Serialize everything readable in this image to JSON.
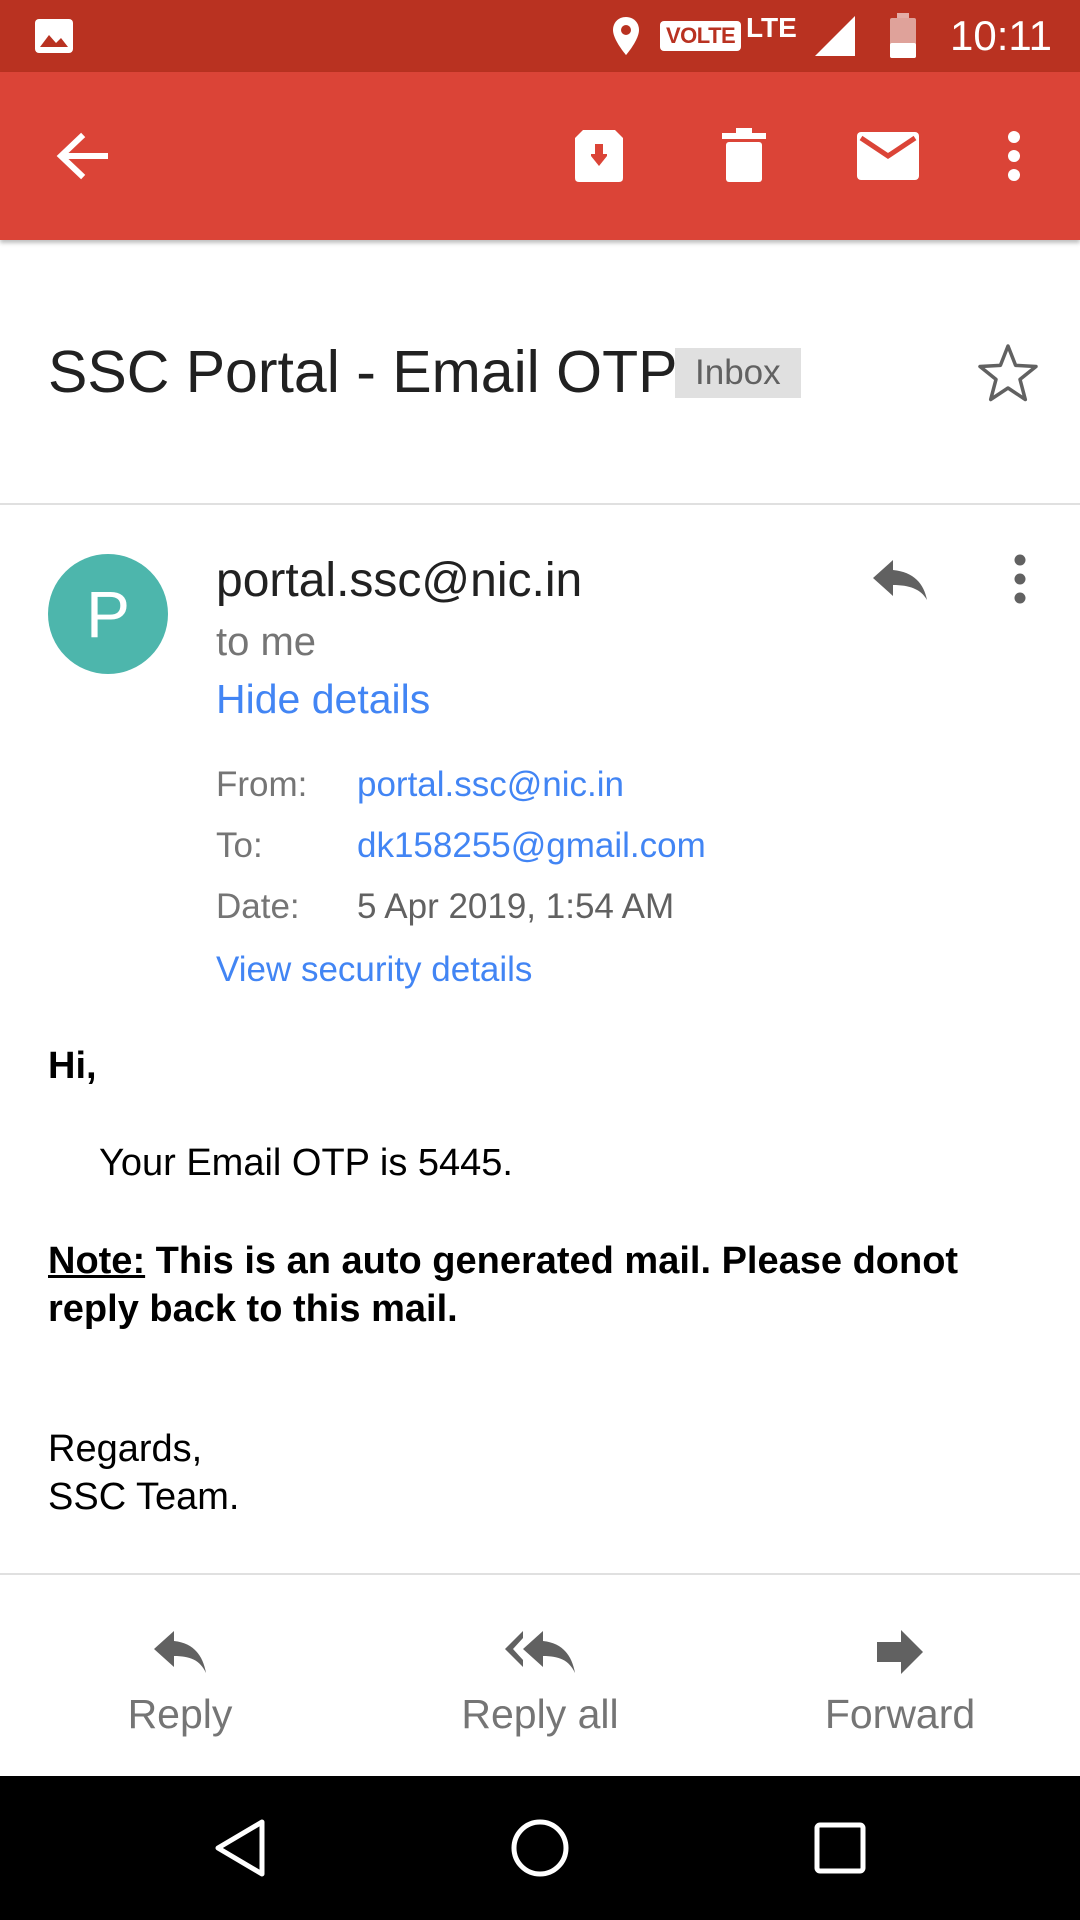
{
  "status_bar": {
    "volte": "VOLTE",
    "network": "LTE",
    "time": "10:11"
  },
  "app_bar": {
    "color": "#db4437",
    "icons": [
      "back-arrow-icon",
      "archive-icon",
      "delete-icon",
      "mail-icon",
      "more-vert-icon"
    ]
  },
  "subject": {
    "title": "SSC Portal - Email OTP",
    "label": "Inbox"
  },
  "sender": {
    "initial": "P",
    "avatar_color": "#4db6ac",
    "name": "portal.ssc@nic.in",
    "recipient": "to me",
    "toggle_details": "Hide details"
  },
  "details": {
    "from_label": "From:",
    "from_value": "portal.ssc@nic.in",
    "to_label": "To:",
    "to_value": "dk158255@gmail.com",
    "date_label": "Date:",
    "date_value": "5 Apr 2019, 1:54 AM",
    "security_link": "View security details"
  },
  "body": {
    "greeting": "Hi,",
    "otp_line": "Your Email OTP is 5445.",
    "note_label": "Note:",
    "note_text": " This is an auto generated mail. Please donot reply back to this mail.",
    "regards": "Regards,",
    "signature": "SSC Team."
  },
  "actions": {
    "reply": "Reply",
    "reply_all": "Reply all",
    "forward": "Forward"
  },
  "colors": {
    "status_bar": "#b93221",
    "link": "#4285f4"
  }
}
